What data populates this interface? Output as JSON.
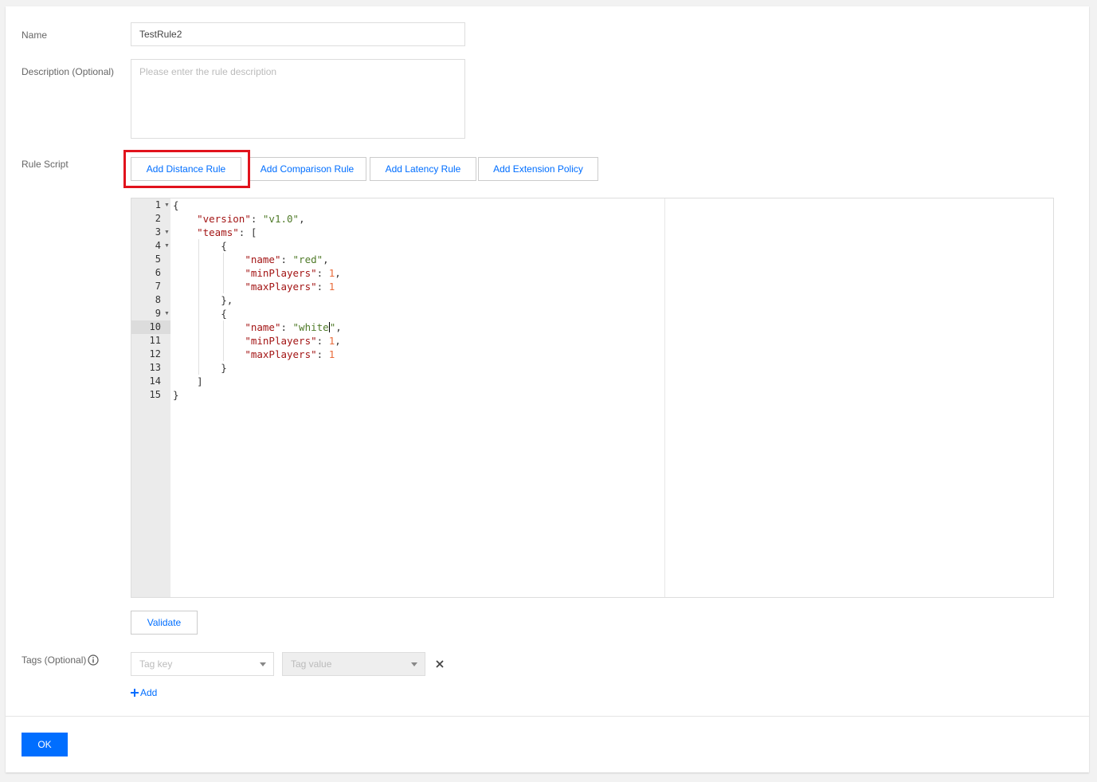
{
  "form": {
    "name_label": "Name",
    "name_value": "TestRule2",
    "description_label": "Description (Optional)",
    "description_placeholder": "Please enter the rule description",
    "rule_script_label": "Rule Script",
    "buttons": {
      "add_distance": "Add Distance Rule",
      "add_comparison": "Add Comparison Rule",
      "add_latency": "Add Latency Rule",
      "add_extension": "Add Extension Policy"
    },
    "validate_label": "Validate",
    "tags_label": "Tags (Optional)",
    "tag_key_placeholder": "Tag key",
    "tag_value_placeholder": "Tag value",
    "add_tag_label": "Add",
    "ok_label": "OK"
  },
  "editor": {
    "line_numbers": [
      "1",
      "2",
      "3",
      "4",
      "5",
      "6",
      "7",
      "8",
      "9",
      "10",
      "11",
      "12",
      "13",
      "14",
      "15"
    ],
    "active_line": "10",
    "fold_lines": [
      "1",
      "3",
      "4",
      "9"
    ],
    "code": {
      "l1_brace": "{",
      "l2_key": "\"version\"",
      "l2_value": "\"v1.0\"",
      "l3_key": "\"teams\"",
      "l3_bracket": "[",
      "l4_brace": "{",
      "l5_key": "\"name\"",
      "l5_value": "\"red\"",
      "l6_key": "\"minPlayers\"",
      "l6_value": "1",
      "l7_key": "\"maxPlayers\"",
      "l7_value": "1",
      "l8_brace": "},",
      "l9_brace": "{",
      "l10_key": "\"name\"",
      "l10_value_a": "\"white",
      "l10_value_b": "\"",
      "l11_key": "\"minPlayers\"",
      "l11_value": "1",
      "l12_key": "\"maxPlayers\"",
      "l12_value": "1",
      "l13_brace": "}",
      "l14_bracket": "]",
      "l15_brace": "}"
    }
  },
  "colors": {
    "accent": "#006eff",
    "highlight_box": "#e1121c",
    "json_key": "#a31515",
    "json_string": "#4f7a28",
    "json_number": "#e96b3a"
  }
}
